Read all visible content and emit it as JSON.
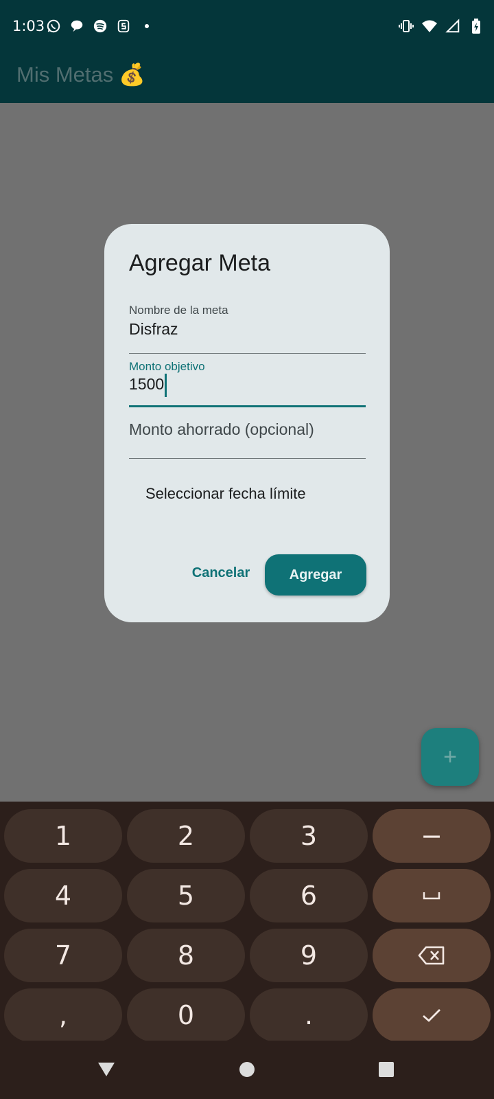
{
  "status_bar": {
    "time": "1:03",
    "left_icons": [
      "whatsapp-icon",
      "chat-bubble-icon",
      "spotify-icon",
      "s-app-icon",
      "dot-icon"
    ],
    "right_icons": [
      "vibrate-icon",
      "wifi-icon",
      "signal-icon",
      "battery-icon"
    ]
  },
  "app_bar": {
    "title": "Mis Metas",
    "emoji": "💰"
  },
  "dialog": {
    "title": "Agregar Meta",
    "fields": [
      {
        "label": "Nombre de la meta",
        "value": "Disfraz",
        "focused": false
      },
      {
        "label": "Monto objetivo",
        "value": "1500",
        "focused": true
      },
      {
        "placeholder": "Monto ahorrado (opcional)",
        "value": ""
      }
    ],
    "date_button": "Seleccionar fecha límite",
    "cancel_label": "Cancelar",
    "add_label": "Agregar"
  },
  "fab": {
    "icon": "plus-icon",
    "label": "+"
  },
  "keyboard": {
    "rows": [
      [
        "1",
        "2",
        "3",
        "−"
      ],
      [
        "4",
        "5",
        "6",
        "␣"
      ],
      [
        "7",
        "8",
        "9",
        "⌫"
      ],
      [
        ",",
        "0",
        ".",
        "✓"
      ]
    ]
  },
  "nav_bar": {
    "icons": [
      "back-icon",
      "home-icon",
      "recents-icon"
    ]
  },
  "colors": {
    "primary": "#0f7276",
    "appbar": "#04363a",
    "scrim": "#717171",
    "dialog_bg": "#e1e8ea",
    "keyboard_bg": "#2c1f1b"
  }
}
